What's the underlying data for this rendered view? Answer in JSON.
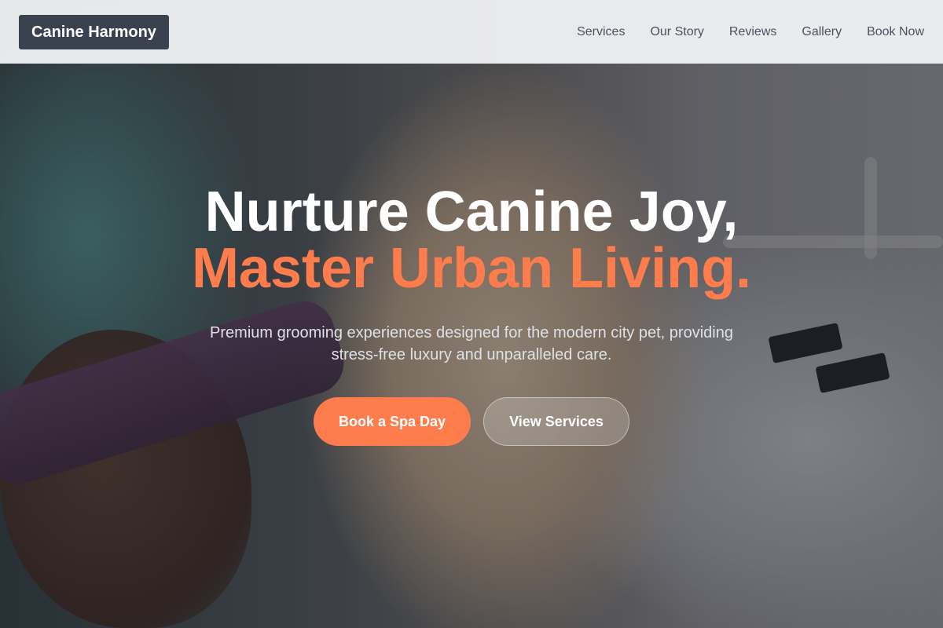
{
  "brand": {
    "name": "Canine Harmony"
  },
  "nav": {
    "items": [
      {
        "label": "Services"
      },
      {
        "label": "Our Story"
      },
      {
        "label": "Reviews"
      },
      {
        "label": "Gallery"
      },
      {
        "label": "Book Now"
      }
    ]
  },
  "hero": {
    "headline_line1": "Nurture Canine Joy,",
    "headline_line2": "Master Urban Living.",
    "subtext": "Premium grooming experiences designed for the modern city pet, providing stress-free luxury and unparalleled care.",
    "primary_button": "Book a Spa Day",
    "secondary_button": "View Services"
  },
  "colors": {
    "accent": "#ff7d4d",
    "logo_bg": "#3a414f",
    "header_bg": "#f1f2f3",
    "nav_text": "#4a5261"
  }
}
